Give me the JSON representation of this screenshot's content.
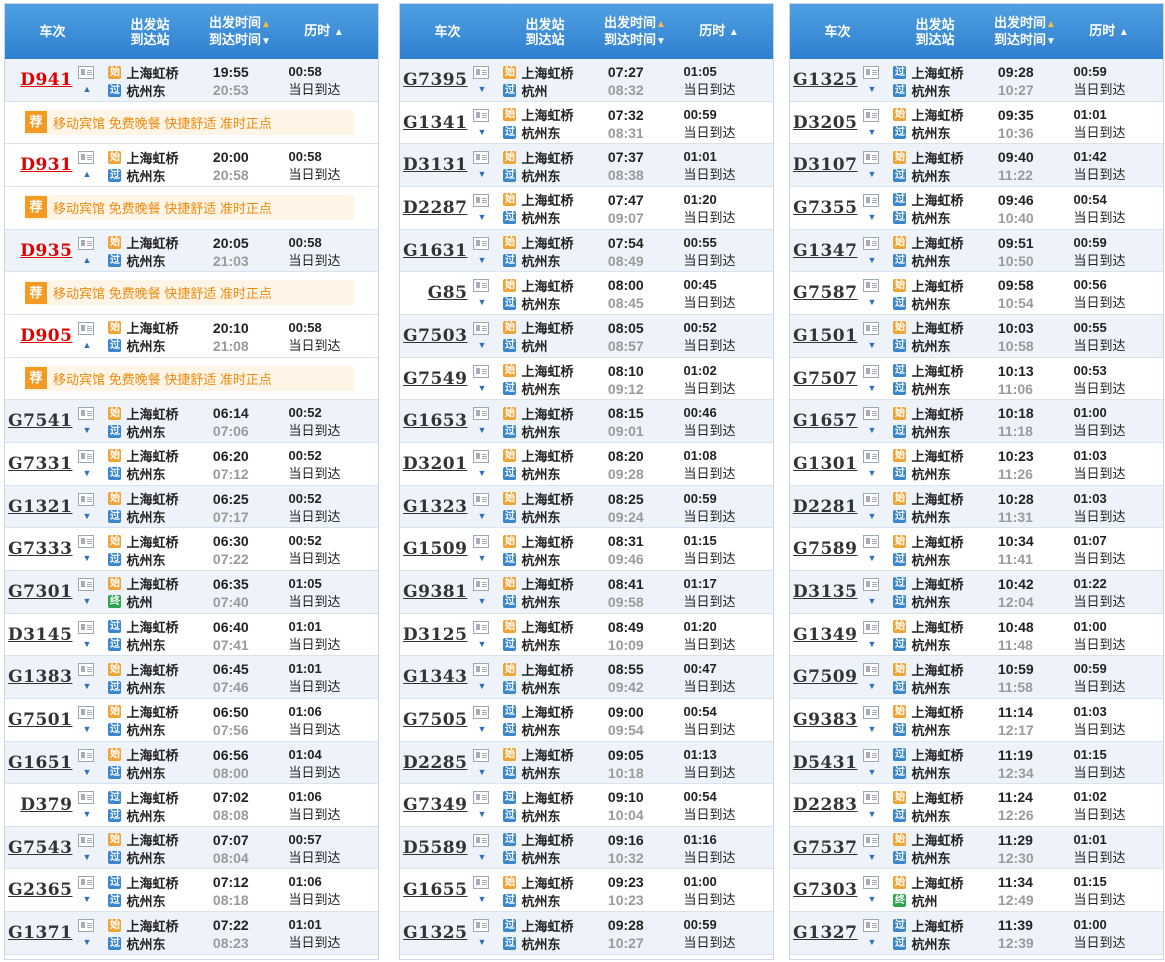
{
  "header": {
    "train": "车次",
    "stations_top": "出发站",
    "stations_bottom": "到达站",
    "time_top": "出发时间",
    "time_bottom": "到达时间",
    "duration": "历时"
  },
  "badges": {
    "start": "始",
    "pass": "过",
    "end": "终"
  },
  "promo": {
    "icon": "荐",
    "text": "移动宾馆 免费晚餐 快捷舒适 准时正点"
  },
  "colors": {
    "header": "#3a8ad6",
    "red_train": "#e00000",
    "badge_start": "#f0a436",
    "badge_pass": "#3a86cf",
    "badge_end": "#2ea44f",
    "promo": "#f08a10"
  },
  "panels": [
    {
      "rows": [
        {
          "type": "train",
          "no": "D941",
          "red": true,
          "dir": "up",
          "from_badge": "始",
          "from": "上海虹桥",
          "to_badge": "过",
          "to": "杭州东",
          "dep": "19:55",
          "arr": "20:53",
          "dur": "00:58",
          "note": "当日到达"
        },
        {
          "type": "promo"
        },
        {
          "type": "train",
          "no": "D931",
          "red": true,
          "dir": "up",
          "from_badge": "始",
          "from": "上海虹桥",
          "to_badge": "过",
          "to": "杭州东",
          "dep": "20:00",
          "arr": "20:58",
          "dur": "00:58",
          "note": "当日到达"
        },
        {
          "type": "promo"
        },
        {
          "type": "train",
          "no": "D935",
          "red": true,
          "dir": "up",
          "from_badge": "始",
          "from": "上海虹桥",
          "to_badge": "过",
          "to": "杭州东",
          "dep": "20:05",
          "arr": "21:03",
          "dur": "00:58",
          "note": "当日到达"
        },
        {
          "type": "promo"
        },
        {
          "type": "train",
          "no": "D905",
          "red": true,
          "dir": "up",
          "from_badge": "始",
          "from": "上海虹桥",
          "to_badge": "过",
          "to": "杭州东",
          "dep": "20:10",
          "arr": "21:08",
          "dur": "00:58",
          "note": "当日到达"
        },
        {
          "type": "promo"
        },
        {
          "type": "train",
          "no": "G7541",
          "dir": "down",
          "from_badge": "始",
          "from": "上海虹桥",
          "to_badge": "过",
          "to": "杭州东",
          "dep": "06:14",
          "arr": "07:06",
          "dur": "00:52",
          "note": "当日到达"
        },
        {
          "type": "train",
          "no": "G7331",
          "dir": "down",
          "from_badge": "始",
          "from": "上海虹桥",
          "to_badge": "过",
          "to": "杭州东",
          "dep": "06:20",
          "arr": "07:12",
          "dur": "00:52",
          "note": "当日到达"
        },
        {
          "type": "train",
          "no": "G1321",
          "dir": "down",
          "from_badge": "始",
          "from": "上海虹桥",
          "to_badge": "过",
          "to": "杭州东",
          "dep": "06:25",
          "arr": "07:17",
          "dur": "00:52",
          "note": "当日到达"
        },
        {
          "type": "train",
          "no": "G7333",
          "dir": "down",
          "from_badge": "始",
          "from": "上海虹桥",
          "to_badge": "过",
          "to": "杭州东",
          "dep": "06:30",
          "arr": "07:22",
          "dur": "00:52",
          "note": "当日到达"
        },
        {
          "type": "train",
          "no": "G7301",
          "dir": "down",
          "from_badge": "始",
          "from": "上海虹桥",
          "to_badge": "终",
          "to": "杭州",
          "dep": "06:35",
          "arr": "07:40",
          "dur": "01:05",
          "note": "当日到达"
        },
        {
          "type": "train",
          "no": "D3145",
          "dir": "down",
          "from_badge": "过",
          "from": "上海虹桥",
          "to_badge": "过",
          "to": "杭州东",
          "dep": "06:40",
          "arr": "07:41",
          "dur": "01:01",
          "note": "当日到达"
        },
        {
          "type": "train",
          "no": "G1383",
          "dir": "down",
          "from_badge": "始",
          "from": "上海虹桥",
          "to_badge": "过",
          "to": "杭州东",
          "dep": "06:45",
          "arr": "07:46",
          "dur": "01:01",
          "note": "当日到达"
        },
        {
          "type": "train",
          "no": "G7501",
          "dir": "down",
          "from_badge": "始",
          "from": "上海虹桥",
          "to_badge": "过",
          "to": "杭州东",
          "dep": "06:50",
          "arr": "07:56",
          "dur": "01:06",
          "note": "当日到达"
        },
        {
          "type": "train",
          "no": "G1651",
          "dir": "down",
          "from_badge": "始",
          "from": "上海虹桥",
          "to_badge": "过",
          "to": "杭州东",
          "dep": "06:56",
          "arr": "08:00",
          "dur": "01:04",
          "note": "当日到达"
        },
        {
          "type": "train",
          "no": "D379",
          "dir": "down",
          "from_badge": "过",
          "from": "上海虹桥",
          "to_badge": "过",
          "to": "杭州东",
          "dep": "07:02",
          "arr": "08:08",
          "dur": "01:06",
          "note": "当日到达"
        },
        {
          "type": "train",
          "no": "G7543",
          "dir": "down",
          "from_badge": "始",
          "from": "上海虹桥",
          "to_badge": "过",
          "to": "杭州东",
          "dep": "07:07",
          "arr": "08:04",
          "dur": "00:57",
          "note": "当日到达"
        },
        {
          "type": "train",
          "no": "G2365",
          "dir": "down",
          "from_badge": "过",
          "from": "上海虹桥",
          "to_badge": "过",
          "to": "杭州东",
          "dep": "07:12",
          "arr": "08:18",
          "dur": "01:06",
          "note": "当日到达"
        },
        {
          "type": "train",
          "no": "G1371",
          "dir": "down",
          "from_badge": "始",
          "from": "上海虹桥",
          "to_badge": "过",
          "to": "杭州东",
          "dep": "07:22",
          "arr": "08:23",
          "dur": "01:01",
          "note": "当日到达"
        }
      ]
    },
    {
      "rows": [
        {
          "type": "train",
          "no": "G7395",
          "dir": "down",
          "from_badge": "始",
          "from": "上海虹桥",
          "to_badge": "过",
          "to": "杭州",
          "dep": "07:27",
          "arr": "08:32",
          "dur": "01:05",
          "note": "当日到达"
        },
        {
          "type": "train",
          "no": "G1341",
          "dir": "down",
          "from_badge": "始",
          "from": "上海虹桥",
          "to_badge": "过",
          "to": "杭州东",
          "dep": "07:32",
          "arr": "08:31",
          "dur": "00:59",
          "note": "当日到达"
        },
        {
          "type": "train",
          "no": "D3131",
          "dir": "down",
          "from_badge": "始",
          "from": "上海虹桥",
          "to_badge": "过",
          "to": "杭州东",
          "dep": "07:37",
          "arr": "08:38",
          "dur": "01:01",
          "note": "当日到达"
        },
        {
          "type": "train",
          "no": "D2287",
          "dir": "down",
          "from_badge": "始",
          "from": "上海虹桥",
          "to_badge": "过",
          "to": "杭州东",
          "dep": "07:47",
          "arr": "09:07",
          "dur": "01:20",
          "note": "当日到达"
        },
        {
          "type": "train",
          "no": "G1631",
          "dir": "down",
          "from_badge": "始",
          "from": "上海虹桥",
          "to_badge": "过",
          "to": "杭州东",
          "dep": "07:54",
          "arr": "08:49",
          "dur": "00:55",
          "note": "当日到达"
        },
        {
          "type": "train",
          "no": "G85",
          "dir": "down",
          "from_badge": "始",
          "from": "上海虹桥",
          "to_badge": "过",
          "to": "杭州东",
          "dep": "08:00",
          "arr": "08:45",
          "dur": "00:45",
          "note": "当日到达"
        },
        {
          "type": "train",
          "no": "G7503",
          "dir": "down",
          "from_badge": "始",
          "from": "上海虹桥",
          "to_badge": "过",
          "to": "杭州",
          "dep": "08:05",
          "arr": "08:57",
          "dur": "00:52",
          "note": "当日到达"
        },
        {
          "type": "train",
          "no": "G7549",
          "dir": "down",
          "from_badge": "始",
          "from": "上海虹桥",
          "to_badge": "过",
          "to": "杭州东",
          "dep": "08:10",
          "arr": "09:12",
          "dur": "01:02",
          "note": "当日到达"
        },
        {
          "type": "train",
          "no": "G1653",
          "dir": "down",
          "from_badge": "始",
          "from": "上海虹桥",
          "to_badge": "过",
          "to": "杭州东",
          "dep": "08:15",
          "arr": "09:01",
          "dur": "00:46",
          "note": "当日到达"
        },
        {
          "type": "train",
          "no": "D3201",
          "dir": "down",
          "from_badge": "始",
          "from": "上海虹桥",
          "to_badge": "过",
          "to": "杭州东",
          "dep": "08:20",
          "arr": "09:28",
          "dur": "01:08",
          "note": "当日到达"
        },
        {
          "type": "train",
          "no": "G1323",
          "dir": "down",
          "from_badge": "始",
          "from": "上海虹桥",
          "to_badge": "过",
          "to": "杭州东",
          "dep": "08:25",
          "arr": "09:24",
          "dur": "00:59",
          "note": "当日到达"
        },
        {
          "type": "train",
          "no": "G1509",
          "dir": "down",
          "from_badge": "始",
          "from": "上海虹桥",
          "to_badge": "过",
          "to": "杭州东",
          "dep": "08:31",
          "arr": "09:46",
          "dur": "01:15",
          "note": "当日到达"
        },
        {
          "type": "train",
          "no": "G9381",
          "dir": "down",
          "from_badge": "始",
          "from": "上海虹桥",
          "to_badge": "过",
          "to": "杭州东",
          "dep": "08:41",
          "arr": "09:58",
          "dur": "01:17",
          "note": "当日到达"
        },
        {
          "type": "train",
          "no": "D3125",
          "dir": "down",
          "from_badge": "始",
          "from": "上海虹桥",
          "to_badge": "过",
          "to": "杭州东",
          "dep": "08:49",
          "arr": "10:09",
          "dur": "01:20",
          "note": "当日到达"
        },
        {
          "type": "train",
          "no": "G1343",
          "dir": "down",
          "from_badge": "始",
          "from": "上海虹桥",
          "to_badge": "过",
          "to": "杭州东",
          "dep": "08:55",
          "arr": "09:42",
          "dur": "00:47",
          "note": "当日到达"
        },
        {
          "type": "train",
          "no": "G7505",
          "dir": "down",
          "from_badge": "过",
          "from": "上海虹桥",
          "to_badge": "过",
          "to": "杭州东",
          "dep": "09:00",
          "arr": "09:54",
          "dur": "00:54",
          "note": "当日到达"
        },
        {
          "type": "train",
          "no": "D2285",
          "dir": "down",
          "from_badge": "始",
          "from": "上海虹桥",
          "to_badge": "过",
          "to": "杭州东",
          "dep": "09:05",
          "arr": "10:18",
          "dur": "01:13",
          "note": "当日到达"
        },
        {
          "type": "train",
          "no": "G7349",
          "dir": "down",
          "from_badge": "过",
          "from": "上海虹桥",
          "to_badge": "过",
          "to": "杭州东",
          "dep": "09:10",
          "arr": "10:04",
          "dur": "00:54",
          "note": "当日到达"
        },
        {
          "type": "train",
          "no": "D5589",
          "dir": "down",
          "from_badge": "过",
          "from": "上海虹桥",
          "to_badge": "过",
          "to": "杭州东",
          "dep": "09:16",
          "arr": "10:32",
          "dur": "01:16",
          "note": "当日到达"
        },
        {
          "type": "train",
          "no": "G1655",
          "dir": "down",
          "from_badge": "始",
          "from": "上海虹桥",
          "to_badge": "过",
          "to": "杭州东",
          "dep": "09:23",
          "arr": "10:23",
          "dur": "01:00",
          "note": "当日到达"
        },
        {
          "type": "train",
          "no": "G1325",
          "dir": "down",
          "from_badge": "过",
          "from": "上海虹桥",
          "to_badge": "过",
          "to": "杭州东",
          "dep": "09:28",
          "arr": "10:27",
          "dur": "00:59",
          "note": "当日到达"
        }
      ]
    },
    {
      "rows": [
        {
          "type": "train",
          "no": "G1325",
          "dir": "down",
          "from_badge": "过",
          "from": "上海虹桥",
          "to_badge": "过",
          "to": "杭州东",
          "dep": "09:28",
          "arr": "10:27",
          "dur": "00:59",
          "note": "当日到达"
        },
        {
          "type": "train",
          "no": "D3205",
          "dir": "down",
          "from_badge": "始",
          "from": "上海虹桥",
          "to_badge": "过",
          "to": "杭州东",
          "dep": "09:35",
          "arr": "10:36",
          "dur": "01:01",
          "note": "当日到达"
        },
        {
          "type": "train",
          "no": "D3107",
          "dir": "down",
          "from_badge": "始",
          "from": "上海虹桥",
          "to_badge": "过",
          "to": "杭州东",
          "dep": "09:40",
          "arr": "11:22",
          "dur": "01:42",
          "note": "当日到达"
        },
        {
          "type": "train",
          "no": "G7355",
          "dir": "down",
          "from_badge": "过",
          "from": "上海虹桥",
          "to_badge": "过",
          "to": "杭州东",
          "dep": "09:46",
          "arr": "10:40",
          "dur": "00:54",
          "note": "当日到达"
        },
        {
          "type": "train",
          "no": "G1347",
          "dir": "down",
          "from_badge": "始",
          "from": "上海虹桥",
          "to_badge": "过",
          "to": "杭州东",
          "dep": "09:51",
          "arr": "10:50",
          "dur": "00:59",
          "note": "当日到达"
        },
        {
          "type": "train",
          "no": "G7587",
          "dir": "down",
          "from_badge": "始",
          "from": "上海虹桥",
          "to_badge": "过",
          "to": "杭州东",
          "dep": "09:58",
          "arr": "10:54",
          "dur": "00:56",
          "note": "当日到达"
        },
        {
          "type": "train",
          "no": "G1501",
          "dir": "down",
          "from_badge": "始",
          "from": "上海虹桥",
          "to_badge": "过",
          "to": "杭州东",
          "dep": "10:03",
          "arr": "10:58",
          "dur": "00:55",
          "note": "当日到达"
        },
        {
          "type": "train",
          "no": "G7507",
          "dir": "down",
          "from_badge": "过",
          "from": "上海虹桥",
          "to_badge": "过",
          "to": "杭州东",
          "dep": "10:13",
          "arr": "11:06",
          "dur": "00:53",
          "note": "当日到达"
        },
        {
          "type": "train",
          "no": "G1657",
          "dir": "down",
          "from_badge": "始",
          "from": "上海虹桥",
          "to_badge": "过",
          "to": "杭州东",
          "dep": "10:18",
          "arr": "11:18",
          "dur": "01:00",
          "note": "当日到达"
        },
        {
          "type": "train",
          "no": "G1301",
          "dir": "down",
          "from_badge": "始",
          "from": "上海虹桥",
          "to_badge": "过",
          "to": "杭州东",
          "dep": "10:23",
          "arr": "11:26",
          "dur": "01:03",
          "note": "当日到达"
        },
        {
          "type": "train",
          "no": "D2281",
          "dir": "down",
          "from_badge": "始",
          "from": "上海虹桥",
          "to_badge": "过",
          "to": "杭州东",
          "dep": "10:28",
          "arr": "11:31",
          "dur": "01:03",
          "note": "当日到达"
        },
        {
          "type": "train",
          "no": "G7589",
          "dir": "down",
          "from_badge": "始",
          "from": "上海虹桥",
          "to_badge": "过",
          "to": "杭州东",
          "dep": "10:34",
          "arr": "11:41",
          "dur": "01:07",
          "note": "当日到达"
        },
        {
          "type": "train",
          "no": "D3135",
          "dir": "down",
          "from_badge": "过",
          "from": "上海虹桥",
          "to_badge": "过",
          "to": "杭州东",
          "dep": "10:42",
          "arr": "12:04",
          "dur": "01:22",
          "note": "当日到达"
        },
        {
          "type": "train",
          "no": "G1349",
          "dir": "down",
          "from_badge": "始",
          "from": "上海虹桥",
          "to_badge": "过",
          "to": "杭州东",
          "dep": "10:48",
          "arr": "11:48",
          "dur": "01:00",
          "note": "当日到达"
        },
        {
          "type": "train",
          "no": "G7509",
          "dir": "down",
          "from_badge": "始",
          "from": "上海虹桥",
          "to_badge": "过",
          "to": "杭州东",
          "dep": "10:59",
          "arr": "11:58",
          "dur": "00:59",
          "note": "当日到达"
        },
        {
          "type": "train",
          "no": "G9383",
          "dir": "down",
          "from_badge": "始",
          "from": "上海虹桥",
          "to_badge": "过",
          "to": "杭州东",
          "dep": "11:14",
          "arr": "12:17",
          "dur": "01:03",
          "note": "当日到达"
        },
        {
          "type": "train",
          "no": "D5431",
          "dir": "down",
          "from_badge": "过",
          "from": "上海虹桥",
          "to_badge": "过",
          "to": "杭州东",
          "dep": "11:19",
          "arr": "12:34",
          "dur": "01:15",
          "note": "当日到达"
        },
        {
          "type": "train",
          "no": "D2283",
          "dir": "down",
          "from_badge": "始",
          "from": "上海虹桥",
          "to_badge": "过",
          "to": "杭州东",
          "dep": "11:24",
          "arr": "12:26",
          "dur": "01:02",
          "note": "当日到达"
        },
        {
          "type": "train",
          "no": "G7537",
          "dir": "down",
          "from_badge": "始",
          "from": "上海虹桥",
          "to_badge": "过",
          "to": "杭州东",
          "dep": "11:29",
          "arr": "12:30",
          "dur": "01:01",
          "note": "当日到达"
        },
        {
          "type": "train",
          "no": "G7303",
          "dir": "down",
          "from_badge": "始",
          "from": "上海虹桥",
          "to_badge": "终",
          "to": "杭州",
          "dep": "11:34",
          "arr": "12:49",
          "dur": "01:15",
          "note": "当日到达"
        },
        {
          "type": "train",
          "no": "G1327",
          "dir": "down",
          "from_badge": "过",
          "from": "上海虹桥",
          "to_badge": "过",
          "to": "杭州东",
          "dep": "11:39",
          "arr": "12:39",
          "dur": "01:00",
          "note": "当日到达"
        }
      ]
    }
  ]
}
